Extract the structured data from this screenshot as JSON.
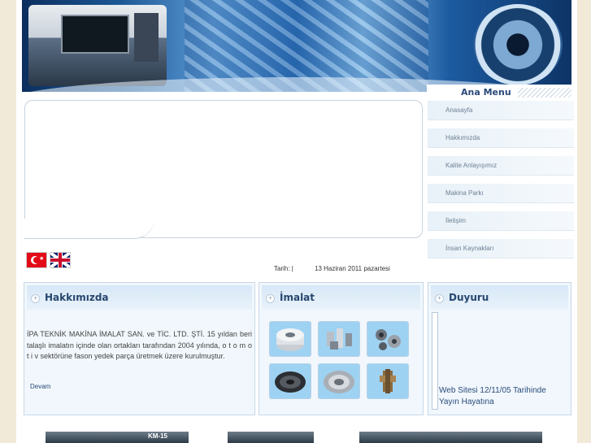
{
  "menu": {
    "title": "Ana Menu",
    "items": [
      {
        "label": "Anasayfa"
      },
      {
        "label": "Hakkımızda"
      },
      {
        "label": "Kalite Anlayışımız"
      },
      {
        "label": "Makina Parkı"
      },
      {
        "label": "İletişim"
      },
      {
        "label": "İnsan Kaynakları"
      }
    ]
  },
  "date": {
    "label": "Tarih: |",
    "value": "13 Haziran 2011 pazartesi"
  },
  "about": {
    "title": "Hakkımızda",
    "text": "İPA TEKNİK MAKİNA İMALAT SAN. ve TİC. LTD. ŞTİ. 15 yıldan beri talaşlı imalatın içinde olan ortakları tarafından 2004 yılında, o t o m o t i v sektörüne fason yedek parça üretmek üzere kurulmuştur.",
    "more": "Devam"
  },
  "imalat": {
    "title": "İmalat"
  },
  "duyuru": {
    "title": "Duyuru",
    "news": "Web Sitesi 12/11/05 Tarihinde Yayın Hayatına"
  },
  "bottom": {
    "label1": "KM-15"
  },
  "colors": {
    "accent": "#27476f",
    "box_bg": "#f1f7fc",
    "page_bg": "#f2ead8"
  }
}
